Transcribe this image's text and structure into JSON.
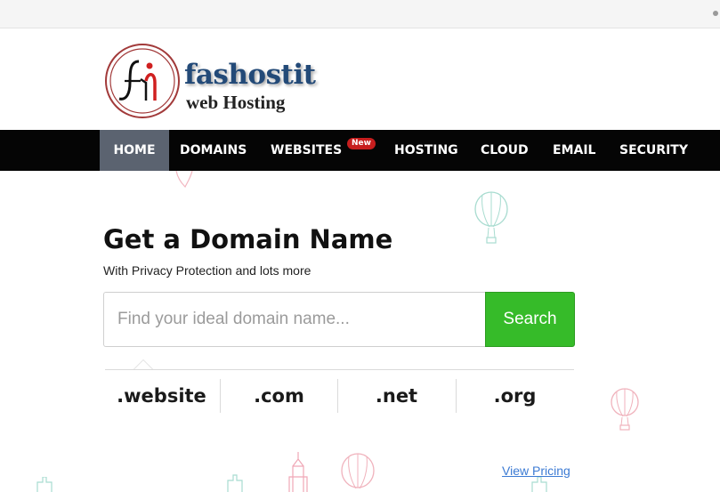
{
  "header": {
    "logo": {
      "brand": "fashostit",
      "tagline": "web Hosting",
      "icon": "fh-monogram-logo"
    }
  },
  "nav": {
    "items": [
      {
        "label": "HOME",
        "active": true
      },
      {
        "label": "DOMAINS"
      },
      {
        "label": "WEBSITES",
        "badge": "New"
      },
      {
        "label": "HOSTING"
      },
      {
        "label": "CLOUD"
      },
      {
        "label": "EMAIL"
      },
      {
        "label": "SECURITY"
      }
    ]
  },
  "hero": {
    "title": "Get a Domain Name",
    "subtitle": "With Privacy Protection and lots more"
  },
  "search": {
    "placeholder": "Find your ideal domain name...",
    "value": "",
    "button_label": "Search"
  },
  "tlds": [
    ".website",
    ".com",
    ".net",
    ".org"
  ],
  "links": {
    "view_pricing": "View Pricing"
  },
  "colors": {
    "nav_bg": "#050505",
    "nav_active": "#5b6370",
    "search_button": "#36bb29",
    "badge": "#c71e1e",
    "link": "#3c7bd4",
    "brand_blue": "#234a78"
  },
  "decorations": [
    "hot-air-balloon-icon",
    "building-icon",
    "building-icon"
  ]
}
